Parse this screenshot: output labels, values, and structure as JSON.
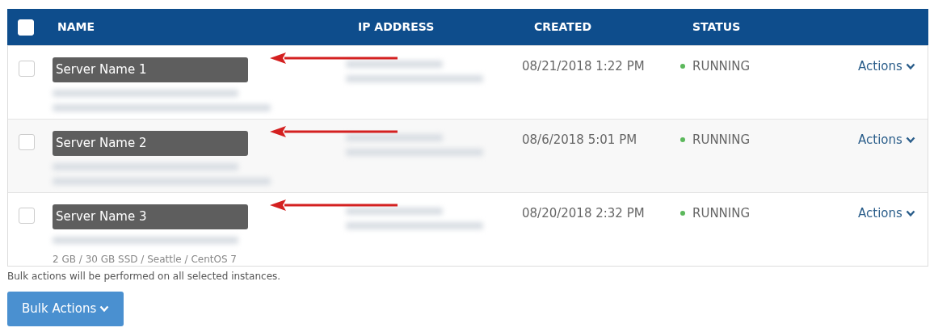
{
  "table": {
    "select_all": {
      "checked": false
    },
    "columns": [
      "NAME",
      "IP ADDRESS",
      "CREATED",
      "STATUS"
    ],
    "rows": [
      {
        "checked": false,
        "name_label": "Server Name 1",
        "specs": null,
        "created": "08/21/2018 1:22 PM",
        "status": "RUNNING",
        "color": "#5cb85c",
        "action": "Actions"
      },
      {
        "checked": false,
        "name_label": "Server Name 2",
        "specs": null,
        "created": "08/6/2018 5:01 PM",
        "status": "RUNNING",
        "color": "#5cb85c",
        "action": "Actions"
      },
      {
        "checked": false,
        "name_label": "Server Name 3",
        "specs": "2 GB / 30 GB SSD / Seattle / CentOS 7",
        "created": "08/20/2018 2:32 PM",
        "status": "RUNNING",
        "color": "#5cb85c",
        "action": "Actions"
      }
    ]
  },
  "bulk_note": "Bulk actions will be performed on all selected instances.",
  "bulk_button": "Bulk Actions"
}
